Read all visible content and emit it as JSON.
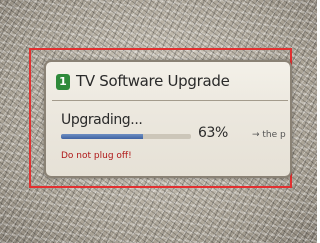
{
  "dialog": {
    "icon": "tv-app-icon",
    "icon_glyph": "1",
    "title": "TV Software Upgrade",
    "status": "Upgrading...",
    "progress": 0.63,
    "progress_label": "63%",
    "cut_text": "→ the p",
    "warning": "Do not plug off!"
  },
  "colors": {
    "frame_highlight": "#e23030",
    "progress_fill": "#3f63a3",
    "icon_background": "#2e8a3a",
    "warning_text": "#b01818"
  }
}
